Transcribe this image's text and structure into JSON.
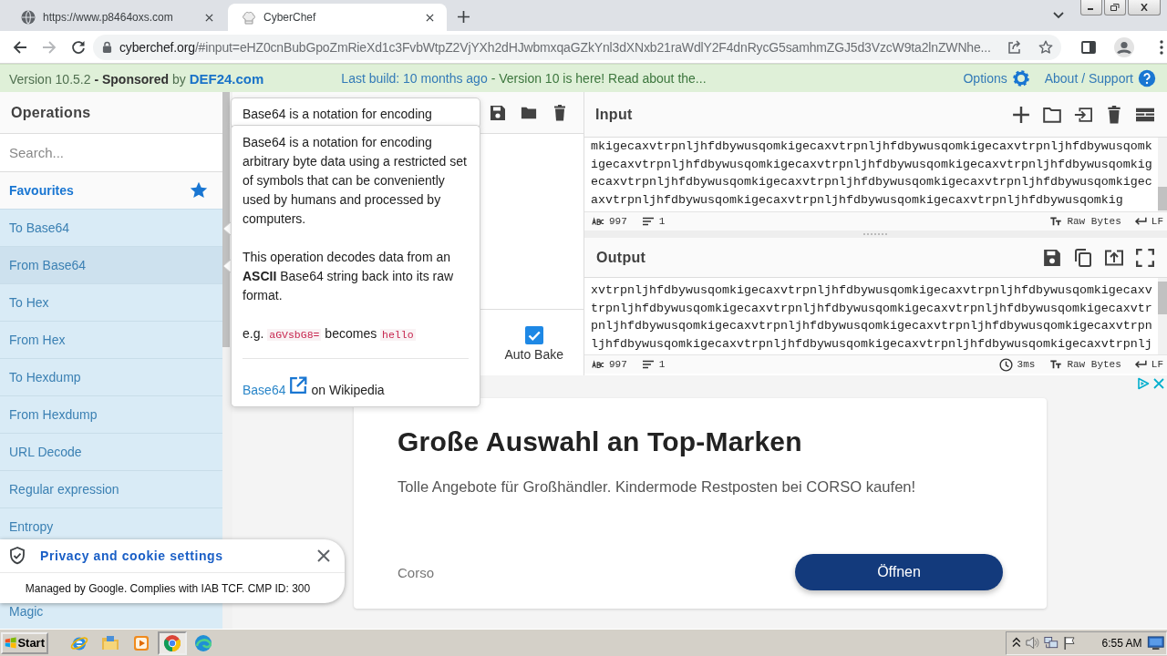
{
  "browser": {
    "tabs": [
      {
        "title": "https://www.p8464oxs.com",
        "kind": "globe",
        "selected": false
      },
      {
        "title": "CyberChef",
        "kind": "chef",
        "selected": true
      }
    ],
    "navigation": {
      "forward_disabled": true
    },
    "url": {
      "host": "cyberchef.org",
      "rest": "/#input=eHZ0cnBubGpoZmRieXd1c3FvbWtpZ2VjYXh2dHJwbmxqaGZkYnl3dXNxb21raWdlY2F4dnRycG5samhmZGJ5d3VzcW9ta2lnZWNhe..."
    }
  },
  "banner": {
    "version_text": "Version 10.5.2 **- Sponsored** by",
    "sponsor": "DEF24.com",
    "build_info": "Last build: 10 months ago",
    "notice": "- Version 10 is here! Read about the...",
    "options": "Options",
    "about": "About / Support"
  },
  "operations": {
    "title": "Operations",
    "search": {
      "placeholder": "Search..."
    },
    "category": "Favourites",
    "items": [
      {
        "label": "To Base64",
        "hovered": false
      },
      {
        "label": "From Base64",
        "hovered": true
      },
      {
        "label": "To Hex",
        "hovered": false
      },
      {
        "label": "From Hex",
        "hovered": false
      },
      {
        "label": "To Hexdump",
        "hovered": false
      },
      {
        "label": "From Hexdump",
        "hovered": false
      },
      {
        "label": "URL Decode",
        "hovered": false
      },
      {
        "label": "Regular expression",
        "hovered": false
      },
      {
        "label": "Entropy",
        "hovered": false
      },
      {
        "label": "Magic",
        "hovered": false
      }
    ]
  },
  "recipe": {
    "auto_bake": {
      "label": "Auto Bake",
      "checked": true
    }
  },
  "popover_behind": {
    "text": "Base64 is a notation for encoding"
  },
  "popover": {
    "paragraphs": [
      "Base64 is a notation for encoding arbitrary byte data using a restricted set of symbols that can be conveniently used by humans and processed by computers.",
      "This operation decodes data from an **ASCII** Base64 string back into its raw format."
    ],
    "example": {
      "prefix": "e.g.",
      "input": "aGVsbG8=",
      "middle": "becomes",
      "output": "hello"
    },
    "link": {
      "label": "Base64",
      "suffix": "on Wikipedia"
    }
  },
  "input": {
    "title": "Input",
    "lines": [
      "mkigecaxvtrpnljhfdbywusqomkigecaxvtrpnljhfdbywusqomkigecaxvtrpnljhfdbywusqomk",
      "igecaxvtrpnljhfdbywusqomkigecaxvtrpnljhfdbywusqomkigecaxvtrpnljhfdbywusqomkig",
      "ecaxvtrpnljhfdbywusqomkigecaxvtrpnljhfdbywusqomkigecaxvtrpnljhfdbywusqomkigec",
      "axvtrpnljhfdbywusqomkigecaxvtrpnljhfdbywusqomkigecaxvtrpnljhfdbywusqomkig"
    ],
    "status": {
      "length": "997",
      "lines": "1",
      "format": "Raw Bytes",
      "eol": "LF"
    }
  },
  "output": {
    "title": "Output",
    "lines": [
      "xvtrpnljhfdbywusqomkigecaxvtrpnljhfdbywusqomkigecaxvtrpnljhfdbywusqomkigecaxv",
      "trpnljhfdbywusqomkigecaxvtrpnljhfdbywusqomkigecaxvtrpnljhfdbywusqomkigecaxvtr",
      "pnljhfdbywusqomkigecaxvtrpnljhfdbywusqomkigecaxvtrpnljhfdbywusqomkigecaxvtrpn",
      "ljhfdbywusqomkigecaxvtrpnljhfdbywusqomkigecaxvtrpnljhfdbywusqomkigecaxvtrpnlj"
    ],
    "status": {
      "length": "997",
      "lines": "1",
      "time": "3ms",
      "format": "Raw Bytes",
      "eol": "LF"
    }
  },
  "cookie_banner": {
    "title": "Privacy and cookie settings",
    "text": "Managed by Google. Complies with IAB TCF. CMP ID: 300"
  },
  "ad": {
    "headline": "Große Auswahl an Top-Marken",
    "description": "Tolle Angebote für Großhändler. Kindermode Restposten bei CORSO kaufen!",
    "advertiser": "Corso",
    "button": "Öffnen"
  },
  "taskbar": {
    "start": "Start",
    "apps": [
      {
        "kind": "ie",
        "selected": false
      },
      {
        "kind": "folder",
        "selected": false
      },
      {
        "kind": "media",
        "selected": false
      },
      {
        "kind": "chrome",
        "selected": true
      },
      {
        "kind": "edge",
        "selected": false
      }
    ],
    "clock": "6:55 AM"
  }
}
